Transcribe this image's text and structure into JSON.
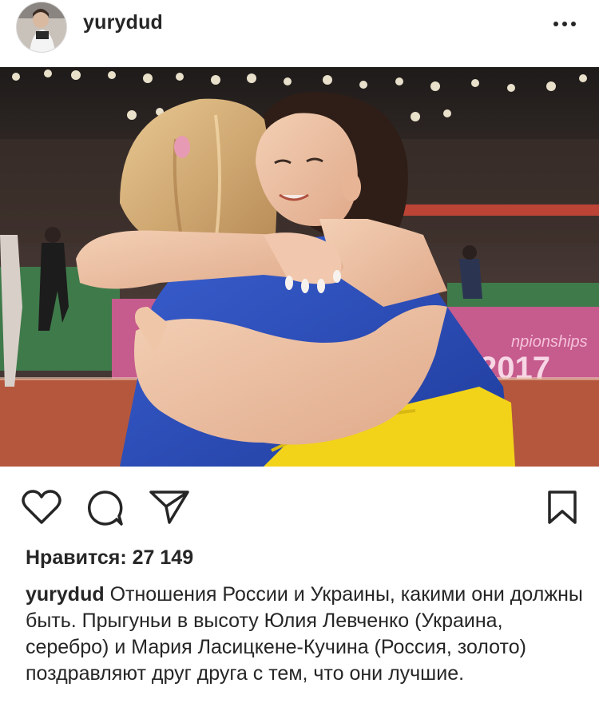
{
  "post": {
    "username": "yurydud",
    "more_label": "•••",
    "likes_text": "Нравится: 27 149",
    "caption_user": "yurydud",
    "caption_text": "Отношения России и Украины, какими они должны быть. Прыгуньи в высоту Юлия Левченко (Украина, серебро) и Мария Ласицкене-Кучина (Россия, золото) поздравляют друг друга с тем, что они лучшие."
  },
  "photo": {
    "banner_text": "npionships",
    "banner_year": "2017"
  },
  "icons": {
    "avatar": "avatar",
    "more": "more-dots-icon",
    "like": "heart-icon",
    "comment": "comment-bubble-icon",
    "share": "paper-plane-icon",
    "save": "bookmark-icon"
  },
  "colors": {
    "text": "#262626",
    "flag_blue": "#2a4fb8",
    "flag_yellow": "#f2d31a"
  }
}
